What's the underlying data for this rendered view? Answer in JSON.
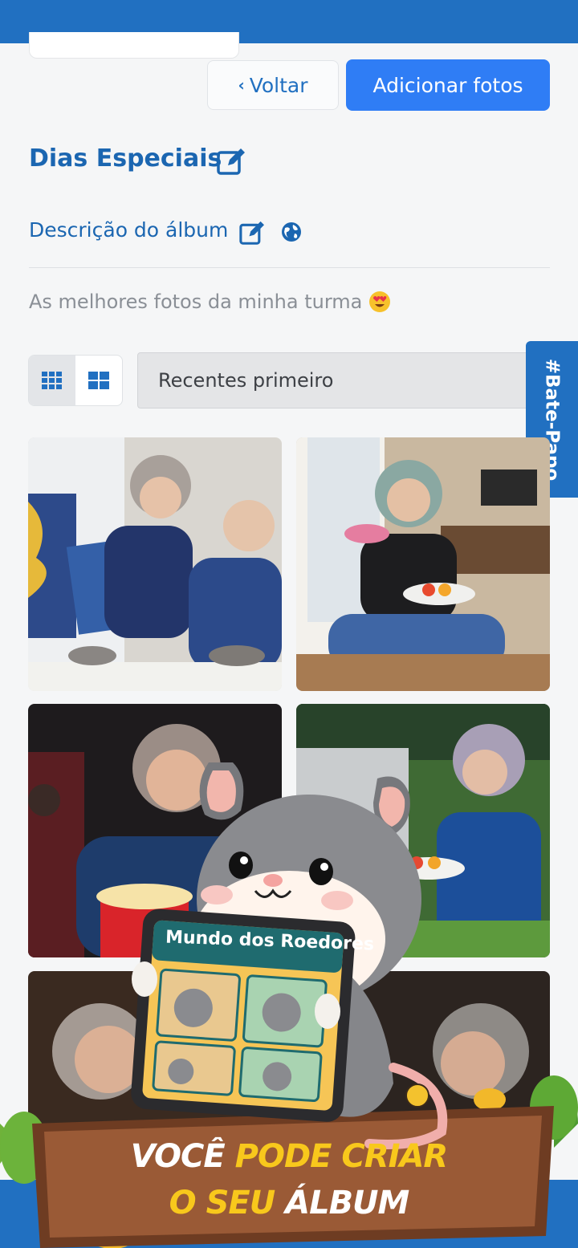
{
  "header": {
    "back_label": "Voltar",
    "add_label": "Adicionar fotos"
  },
  "album": {
    "title": "Dias Especiais",
    "description_label": "Descrição do álbum",
    "description": "As melhores fotos da minha turma"
  },
  "controls": {
    "sort_selected": "Recentes primeiro"
  },
  "chat_tab": {
    "label": "#Bate-Papo"
  },
  "promo": {
    "tablet_title": "Mundo dos Roedores",
    "line1_white": "VOCÊ",
    "line1_yellow": "PODE CRIAR",
    "line2_yellow": "O SEU",
    "line2_white": "ÁLBUM"
  },
  "colors": {
    "brand": "#2170c1",
    "primary_button": "#2f7df5",
    "promo_yellow": "#f8c81c"
  },
  "icons": [
    "chevron-left-icon",
    "edit-icon",
    "globe-icon",
    "grid-small-icon",
    "grid-large-icon"
  ]
}
